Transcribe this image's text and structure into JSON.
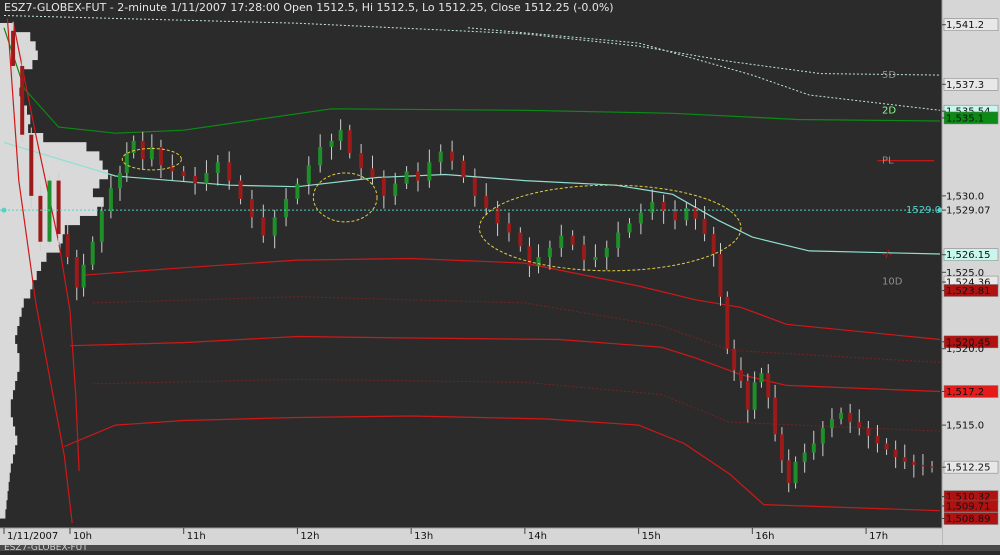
{
  "window": {
    "title": "ESZ7-GLOBEX-FUT - 2-minute 1/11/2007 17:28:00 Open 1512.5, Hi 1512.5, Lo 1512.25, Close 1512.25 (-0.0%)",
    "status_bar": "ESZ7-GLOBEX-FUT"
  },
  "colors": {
    "background": "#2b2b2b",
    "axis_panel": "#d6d6d6",
    "up_candle": "#1f8f2a",
    "down_candle": "#9b1a1a",
    "wick": "#cfcfcf",
    "volume_profile": "#d9d9d9",
    "band_red": "#d01818",
    "band_red_dotted": "#7a2222",
    "band_green": "#0c8a16",
    "band_cyan": "#8fe0d0",
    "band_5d": "#bfe6de",
    "highlight_ellipse": "#e0d040",
    "crosshair": "#56d0c8"
  },
  "chart_data": {
    "type": "candlestick",
    "symbol": "ESZ7-GLOBEX-FUT",
    "interval": "2-minute",
    "date": "1/11/2007",
    "last_bar": {
      "time": "17:28:00",
      "open": 1512.5,
      "high": 1512.5,
      "low": 1512.25,
      "close": 1512.25,
      "change": "(-0.0%)"
    },
    "ylim": [
      1508.4,
      1541.9
    ],
    "y_ticks": [
      "1,541.2",
      "1,537.3",
      "1,535.54",
      "1,535.1",
      "1,530.0",
      "1,529.07",
      "1,526.15",
      "1,525.0",
      "1,524.36",
      "1,523.81",
      "1,520.45",
      "1,520.0",
      "1,517.2",
      "1,515.0",
      "1,512.25",
      "1,510.32",
      "1,509.71",
      "1,508.89"
    ],
    "y_tick_values": [
      1541.2,
      1537.3,
      1535.54,
      1535.1,
      1530.0,
      1529.07,
      1526.15,
      1525.0,
      1524.36,
      1523.81,
      1520.45,
      1520.0,
      1517.2,
      1515.0,
      1512.25,
      1510.32,
      1509.71,
      1508.89
    ],
    "x_ticks": [
      "1/11/2007",
      "10h",
      "11h",
      "12h",
      "13h",
      "14h",
      "15h",
      "16h",
      "17h"
    ],
    "x_tick_hours": [
      9.42,
      10.0,
      11.0,
      12.0,
      13.0,
      14.0,
      15.0,
      16.0,
      17.0
    ],
    "xlim": [
      9.42,
      17.65
    ],
    "line_labels": [
      {
        "text": "5D",
        "value": 1537.9
      },
      {
        "text": "2D",
        "value": 1535.6
      },
      {
        "text": "PL",
        "value": 1532.3
      },
      {
        "text": "-/-",
        "value": 1526.2
      },
      {
        "text": "10D",
        "value": 1524.4
      },
      {
        "text": "1529.07",
        "value": 1529.07
      }
    ],
    "crosshair_value": 1529.07,
    "bands": [
      {
        "name": "5D",
        "style": "dotted",
        "color_key": "band_5d",
        "points": [
          [
            9.42,
            1541.8
          ],
          [
            12.0,
            1541.3
          ],
          [
            14.0,
            1540.6
          ],
          [
            15.0,
            1539.8
          ],
          [
            15.8,
            1538.8
          ],
          [
            16.6,
            1538.0
          ],
          [
            17.65,
            1537.9
          ]
        ]
      },
      {
        "name": "5D-low",
        "style": "dotted",
        "color_key": "band_5d",
        "points": [
          [
            13.5,
            1541.0
          ],
          [
            15.0,
            1540.0
          ],
          [
            16.0,
            1537.9
          ],
          [
            16.5,
            1536.6
          ],
          [
            17.65,
            1535.6
          ]
        ]
      },
      {
        "name": "2D",
        "style": "solid",
        "color_key": "band_green",
        "points": [
          [
            9.42,
            1541.0
          ],
          [
            9.6,
            1537.0
          ],
          [
            9.9,
            1534.5
          ],
          [
            10.4,
            1534.1
          ],
          [
            11.0,
            1534.3
          ],
          [
            12.3,
            1535.7
          ],
          [
            14.0,
            1535.6
          ],
          [
            15.3,
            1535.4
          ],
          [
            16.4,
            1535.0
          ],
          [
            17.65,
            1534.9
          ]
        ]
      },
      {
        "name": "cyan",
        "style": "solid",
        "color_key": "band_cyan",
        "points": [
          [
            9.42,
            1533.5
          ],
          [
            10.4,
            1531.3
          ],
          [
            11.4,
            1530.7
          ],
          [
            12.0,
            1530.6
          ],
          [
            12.7,
            1531.2
          ],
          [
            13.3,
            1531.4
          ],
          [
            14.0,
            1531.0
          ],
          [
            14.8,
            1530.7
          ],
          [
            15.3,
            1530.1
          ],
          [
            15.7,
            1528.4
          ],
          [
            16.0,
            1527.3
          ],
          [
            16.5,
            1526.4
          ],
          [
            17.65,
            1526.2
          ]
        ]
      },
      {
        "name": "red-inner",
        "style": "solid",
        "color_key": "band_red",
        "points": [
          [
            10.1,
            1524.8
          ],
          [
            11.0,
            1525.3
          ],
          [
            12.0,
            1525.8
          ],
          [
            13.0,
            1525.9
          ],
          [
            14.0,
            1525.6
          ],
          [
            15.0,
            1524.1
          ],
          [
            15.5,
            1523.2
          ],
          [
            15.9,
            1522.7
          ],
          [
            16.3,
            1521.6
          ],
          [
            17.65,
            1520.6
          ]
        ]
      },
      {
        "name": "red-mid",
        "style": "solid",
        "color_key": "band_red",
        "points": [
          [
            10.0,
            1520.2
          ],
          [
            11.0,
            1520.4
          ],
          [
            12.0,
            1520.8
          ],
          [
            13.0,
            1520.7
          ],
          [
            14.3,
            1520.6
          ],
          [
            15.2,
            1520.1
          ],
          [
            15.5,
            1519.4
          ],
          [
            15.9,
            1518.3
          ],
          [
            16.3,
            1517.6
          ],
          [
            17.65,
            1517.2
          ]
        ]
      },
      {
        "name": "red-outer",
        "style": "solid",
        "color_key": "band_red",
        "points": [
          [
            9.95,
            1513.6
          ],
          [
            10.4,
            1515.0
          ],
          [
            11.0,
            1515.3
          ],
          [
            12.0,
            1515.5
          ],
          [
            13.0,
            1515.6
          ],
          [
            14.2,
            1515.4
          ],
          [
            15.0,
            1515.0
          ],
          [
            15.4,
            1513.8
          ],
          [
            15.8,
            1511.8
          ],
          [
            16.1,
            1509.8
          ],
          [
            17.65,
            1509.4
          ]
        ]
      },
      {
        "name": "red-left",
        "style": "solid",
        "color_key": "band_red",
        "points": [
          [
            9.45,
            1541.6
          ],
          [
            9.55,
            1531.0
          ],
          [
            9.7,
            1523.0
          ],
          [
            9.85,
            1517.0
          ],
          [
            9.95,
            1513.0
          ],
          [
            10.02,
            1508.6
          ]
        ]
      },
      {
        "name": "red-left2",
        "style": "solid",
        "color_key": "band_red",
        "points": [
          [
            9.5,
            1541.4
          ],
          [
            9.7,
            1534.0
          ],
          [
            9.9,
            1527.0
          ],
          [
            10.0,
            1522.5
          ],
          [
            10.05,
            1517.0
          ],
          [
            10.08,
            1512.0
          ]
        ]
      },
      {
        "name": "red-dotted-1",
        "style": "dotted",
        "color_key": "band_red_dotted",
        "points": [
          [
            10.2,
            1523.0
          ],
          [
            12.0,
            1523.4
          ],
          [
            14.0,
            1523.0
          ],
          [
            15.2,
            1521.5
          ],
          [
            15.8,
            1519.9
          ],
          [
            17.65,
            1519.1
          ]
        ]
      },
      {
        "name": "red-dotted-2",
        "style": "dotted",
        "color_key": "band_red_dotted",
        "points": [
          [
            10.2,
            1517.7
          ],
          [
            12.0,
            1518.0
          ],
          [
            14.0,
            1517.8
          ],
          [
            15.2,
            1517.0
          ],
          [
            15.8,
            1515.2
          ],
          [
            17.65,
            1514.6
          ]
        ]
      },
      {
        "name": "PL",
        "style": "solid",
        "color_key": "band_red",
        "points": [
          [
            17.1,
            1532.3
          ],
          [
            17.6,
            1532.3
          ]
        ]
      }
    ],
    "close_path": [
      [
        9.42,
        1540.8
      ],
      [
        9.5,
        1538.5
      ],
      [
        9.58,
        1534.0
      ],
      [
        9.66,
        1530.0
      ],
      [
        9.74,
        1527.0
      ],
      [
        9.82,
        1531.0
      ],
      [
        9.9,
        1527.5
      ],
      [
        9.98,
        1526.0
      ],
      [
        10.06,
        1524.0
      ],
      [
        10.12,
        1525.5
      ],
      [
        10.2,
        1527.0
      ],
      [
        10.28,
        1529.0
      ],
      [
        10.36,
        1530.5
      ],
      [
        10.44,
        1531.5
      ],
      [
        10.5,
        1532.8
      ],
      [
        10.56,
        1533.6
      ],
      [
        10.64,
        1532.4
      ],
      [
        10.72,
        1533.2
      ],
      [
        10.8,
        1532.0
      ],
      [
        10.9,
        1531.6
      ],
      [
        11.0,
        1531.3
      ],
      [
        11.1,
        1530.8
      ],
      [
        11.2,
        1531.5
      ],
      [
        11.3,
        1532.2
      ],
      [
        11.4,
        1531.0
      ],
      [
        11.5,
        1529.8
      ],
      [
        11.6,
        1528.6
      ],
      [
        11.7,
        1527.4
      ],
      [
        11.8,
        1528.6
      ],
      [
        11.9,
        1529.8
      ],
      [
        12.0,
        1530.8
      ],
      [
        12.1,
        1532.0
      ],
      [
        12.2,
        1533.2
      ],
      [
        12.3,
        1533.6
      ],
      [
        12.38,
        1534.3
      ],
      [
        12.46,
        1532.8
      ],
      [
        12.56,
        1531.8
      ],
      [
        12.66,
        1531.2
      ],
      [
        12.76,
        1530.0
      ],
      [
        12.86,
        1530.8
      ],
      [
        12.96,
        1531.6
      ],
      [
        13.06,
        1531.0
      ],
      [
        13.16,
        1532.2
      ],
      [
        13.26,
        1532.9
      ],
      [
        13.36,
        1532.3
      ],
      [
        13.46,
        1531.2
      ],
      [
        13.56,
        1530.0
      ],
      [
        13.66,
        1529.2
      ],
      [
        13.76,
        1528.2
      ],
      [
        13.86,
        1527.6
      ],
      [
        13.96,
        1526.7
      ],
      [
        14.04,
        1525.4
      ],
      [
        14.12,
        1526.0
      ],
      [
        14.22,
        1526.6
      ],
      [
        14.32,
        1527.4
      ],
      [
        14.42,
        1526.8
      ],
      [
        14.52,
        1525.8
      ],
      [
        14.62,
        1526.0
      ],
      [
        14.72,
        1526.6
      ],
      [
        14.82,
        1527.6
      ],
      [
        14.92,
        1528.2
      ],
      [
        15.02,
        1528.9
      ],
      [
        15.12,
        1529.6
      ],
      [
        15.22,
        1529.0
      ],
      [
        15.32,
        1528.4
      ],
      [
        15.42,
        1529.2
      ],
      [
        15.5,
        1528.5
      ],
      [
        15.58,
        1527.5
      ],
      [
        15.66,
        1526.2
      ],
      [
        15.72,
        1523.4
      ],
      [
        15.78,
        1520.0
      ],
      [
        15.84,
        1518.6
      ],
      [
        15.9,
        1517.9
      ],
      [
        15.96,
        1516.0
      ],
      [
        16.02,
        1517.8
      ],
      [
        16.08,
        1518.4
      ],
      [
        16.14,
        1516.8
      ],
      [
        16.2,
        1514.4
      ],
      [
        16.26,
        1512.7
      ],
      [
        16.32,
        1511.2
      ],
      [
        16.38,
        1512.6
      ],
      [
        16.46,
        1513.2
      ],
      [
        16.54,
        1513.8
      ],
      [
        16.62,
        1514.8
      ],
      [
        16.7,
        1515.4
      ],
      [
        16.78,
        1515.8
      ],
      [
        16.86,
        1515.2
      ],
      [
        16.94,
        1514.8
      ],
      [
        17.02,
        1514.3
      ],
      [
        17.1,
        1513.8
      ],
      [
        17.18,
        1513.4
      ],
      [
        17.26,
        1512.9
      ],
      [
        17.34,
        1512.6
      ],
      [
        17.42,
        1512.4
      ],
      [
        17.5,
        1512.3
      ],
      [
        17.58,
        1512.25
      ]
    ],
    "highlights": [
      {
        "cx": 12.42,
        "cy": 1529.9,
        "rx": 0.28,
        "ry": 1.6
      },
      {
        "cx": 14.75,
        "cy": 1527.9,
        "rx": 1.15,
        "ry": 2.8
      },
      {
        "cx": 10.72,
        "cy": 1532.4,
        "rx": 0.26,
        "ry": 0.7
      }
    ],
    "volume_profile": {
      "bins": [
        [
          1541.0,
          0.12
        ],
        [
          1540.4,
          0.28
        ],
        [
          1539.8,
          0.33
        ],
        [
          1539.2,
          0.35
        ],
        [
          1538.6,
          0.3
        ],
        [
          1538.0,
          0.22
        ],
        [
          1537.4,
          0.2
        ],
        [
          1536.8,
          0.18
        ],
        [
          1536.2,
          0.22
        ],
        [
          1535.6,
          0.25
        ],
        [
          1535.0,
          0.28
        ],
        [
          1534.4,
          0.26
        ],
        [
          1533.8,
          0.4
        ],
        [
          1533.2,
          0.8
        ],
        [
          1532.6,
          0.92
        ],
        [
          1532.0,
          0.95
        ],
        [
          1531.4,
          1.0
        ],
        [
          1530.8,
          0.92
        ],
        [
          1530.2,
          0.86
        ],
        [
          1529.6,
          0.96
        ],
        [
          1529.0,
          0.9
        ],
        [
          1528.4,
          0.74
        ],
        [
          1527.8,
          0.6
        ],
        [
          1527.2,
          0.58
        ],
        [
          1526.6,
          0.56
        ],
        [
          1526.0,
          0.43
        ],
        [
          1525.4,
          0.38
        ],
        [
          1524.8,
          0.34
        ],
        [
          1524.2,
          0.3
        ],
        [
          1523.6,
          0.28
        ],
        [
          1523.0,
          0.22
        ],
        [
          1522.4,
          0.2
        ],
        [
          1521.8,
          0.18
        ],
        [
          1521.2,
          0.16
        ],
        [
          1520.6,
          0.14
        ],
        [
          1520.0,
          0.16
        ],
        [
          1519.4,
          0.18
        ],
        [
          1518.8,
          0.18
        ],
        [
          1518.2,
          0.16
        ],
        [
          1517.6,
          0.14
        ],
        [
          1517.0,
          0.12
        ],
        [
          1516.4,
          0.1
        ],
        [
          1515.8,
          0.1
        ],
        [
          1515.2,
          0.12
        ],
        [
          1514.6,
          0.14
        ],
        [
          1514.0,
          0.16
        ],
        [
          1513.4,
          0.14
        ],
        [
          1512.8,
          0.12
        ],
        [
          1512.2,
          0.1
        ],
        [
          1511.6,
          0.09
        ],
        [
          1511.0,
          0.08
        ],
        [
          1510.4,
          0.07
        ],
        [
          1509.8,
          0.06
        ],
        [
          1509.2,
          0.05
        ]
      ],
      "max_hours": 0.95
    }
  }
}
